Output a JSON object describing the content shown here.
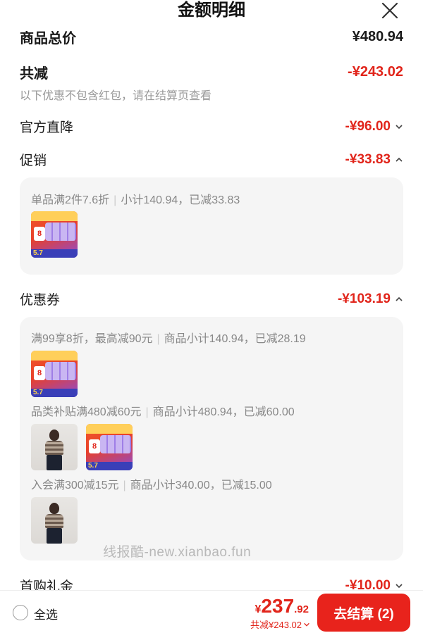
{
  "header": {
    "title": "金额明细",
    "close_icon": "close-icon"
  },
  "rows": {
    "total_price": {
      "label": "商品总价",
      "value": "¥480.94"
    },
    "total_discount": {
      "label": "共减",
      "value": "-¥243.02",
      "note": "以下优惠不包含红包，请在结算页查看"
    },
    "official": {
      "label": "官方直降",
      "value": "-¥96.00"
    },
    "promo": {
      "label": "促销",
      "value": "-¥33.83"
    },
    "coupon": {
      "label": "优惠券",
      "value": "-¥103.19"
    },
    "first": {
      "label": "首购礼金",
      "value": "-¥10.00"
    }
  },
  "promo_panel": {
    "line": {
      "desc": "单品满2件7.6折",
      "subtotal": "小计140.94，已减33.83"
    }
  },
  "coupon_panel": {
    "line1": {
      "desc": "满99享8折，最高减90元",
      "subtotal": "商品小计140.94，已减28.19"
    },
    "line2": {
      "desc": "品类补贴满480减60元",
      "subtotal": "商品小计480.94，已减60.00"
    },
    "line3": {
      "desc": "入会满300减15元",
      "subtotal": "商品小计340.00，已减15.00"
    }
  },
  "product_badge": {
    "num": "5.7",
    "badge": "8"
  },
  "watermark": "线报酷-new.xianbao.fun",
  "footer": {
    "select_all": "全选",
    "currency": "¥",
    "price_int": "237",
    "price_dec": ".92",
    "subtotal": "共减¥243.02",
    "checkout": "去结算 (2)"
  },
  "colors": {
    "accent": "#e1251b",
    "button": "#e8231c",
    "panel": "#f5f5f5"
  }
}
